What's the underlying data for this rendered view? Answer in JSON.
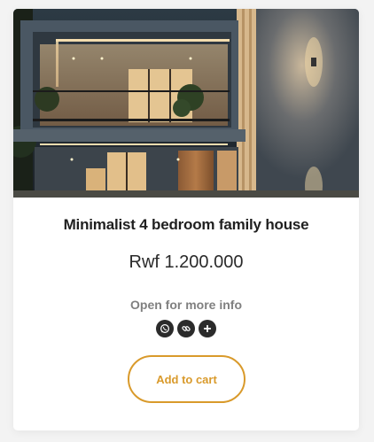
{
  "product": {
    "title": "Minimalist 4 bedroom family house",
    "price": "Rwf 1.200.000",
    "more_info": "Open for more info",
    "add_to_cart_label": "Add to cart",
    "image_subject": "modern two-storey house at dusk",
    "share_icons": [
      "whatsapp-icon",
      "link-icon",
      "plus-icon"
    ]
  },
  "colors": {
    "accent": "#d99a2b",
    "title": "#1f1f1f",
    "muted": "#808080",
    "icon_bg": "#2b2b2b"
  }
}
